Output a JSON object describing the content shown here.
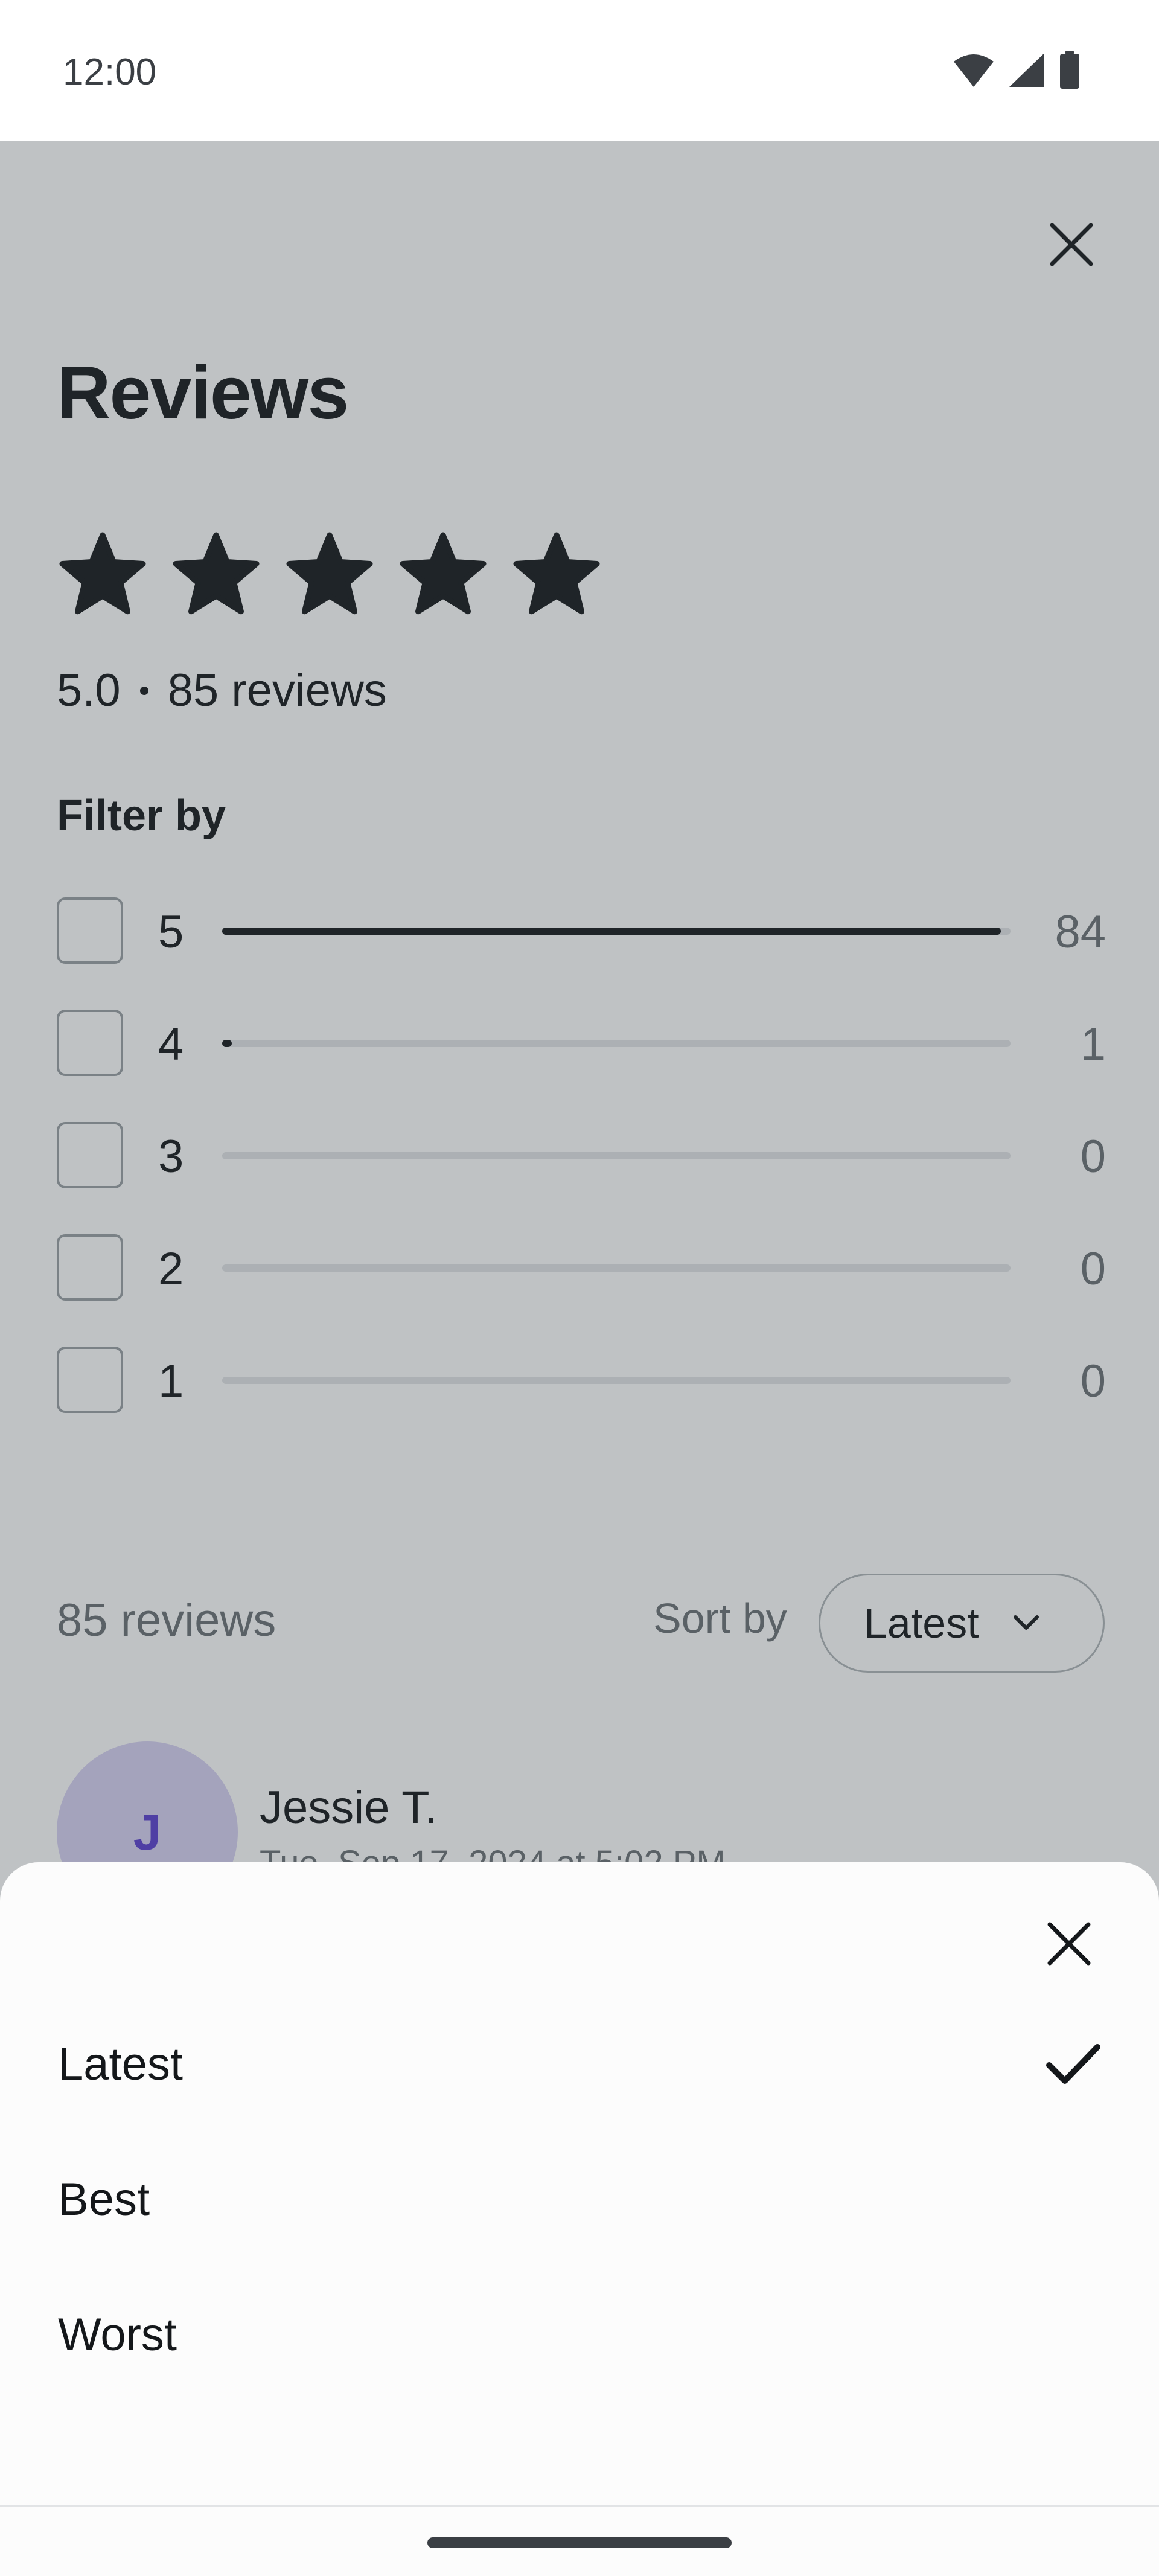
{
  "status_bar": {
    "time": "12:00",
    "icons": [
      "wifi-icon",
      "signal-icon",
      "battery-icon"
    ]
  },
  "reviews": {
    "title": "Reviews",
    "stars_filled": 5,
    "rating": "5.0",
    "total_reviews_label": "85 reviews",
    "filter_label": "Filter by",
    "filter_rows": [
      {
        "stars": "5",
        "count": "84",
        "fraction": 0.988
      },
      {
        "stars": "4",
        "count": "1",
        "fraction": 0.012
      },
      {
        "stars": "3",
        "count": "0",
        "fraction": 0
      },
      {
        "stars": "2",
        "count": "0",
        "fraction": 0
      },
      {
        "stars": "1",
        "count": "0",
        "fraction": 0
      }
    ],
    "list_count_label": "85 reviews",
    "sort_label": "Sort by",
    "sort_value": "Latest",
    "first_review": {
      "initial": "J",
      "name": "Jessie T.",
      "date": "Tue, Sep 17, 2024 at 5:02 PM"
    }
  },
  "sort_sheet": {
    "options": [
      {
        "label": "Latest",
        "selected": true
      },
      {
        "label": "Best",
        "selected": false
      },
      {
        "label": "Worst",
        "selected": false
      }
    ]
  },
  "colors": {
    "text": "#14171a",
    "muted": "#6a7075",
    "avatar_bg": "#d8d2f3",
    "avatar_text": "#5a3fd0",
    "scrim": "rgba(55,66,72,0.32)"
  }
}
